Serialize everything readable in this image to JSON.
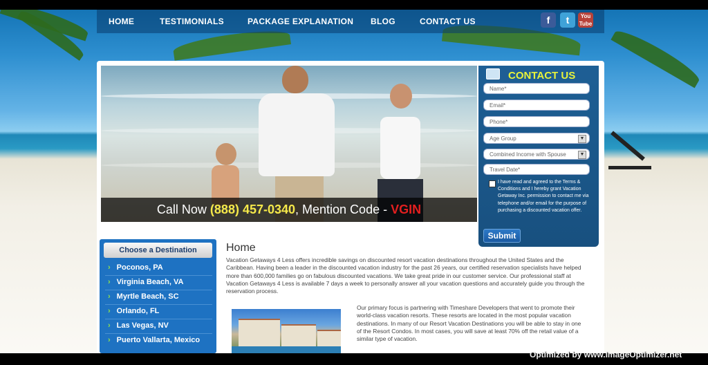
{
  "nav": {
    "items": [
      "HOME",
      "TESTIMONIALS",
      "PACKAGE EXPLANATION",
      "BLOG",
      "CONTACT US"
    ]
  },
  "social": {
    "facebook": "f",
    "twitter": "t",
    "youtube": "You Tube"
  },
  "hero": {
    "call_prefix": "Call Now ",
    "phone": "(888) 457-0340",
    "mention": ", Mention Code - ",
    "code": "VGIN"
  },
  "contact_form": {
    "title": "CONTACT US",
    "name_placeholder": "Name*",
    "email_placeholder": "Email*",
    "phone_placeholder": "Phone*",
    "age_group": "Age Group",
    "income": "Combined Income with Spouse",
    "travel_date_placeholder": "Travel Date*",
    "terms": "I have read and agreed to the Terms & Conditions and I hereby grant Vacation Getaway Inc. permission to contact me via telephone and/or email for the purpose of purchasing a discounted vacation offer.",
    "submit": "Submit"
  },
  "destinations": {
    "title": "Choose a Destination",
    "items": [
      "Poconos, PA",
      "Virginia Beach, VA",
      "Myrtle Beach, SC",
      "Orlando, FL",
      "Las Vegas, NV",
      "Puerto Vallarta, Mexico"
    ]
  },
  "main": {
    "title": "Home",
    "para1": "Vacation Getaways 4 Less offers incredible savings on discounted resort vacation destinations throughout the United States and the Caribbean. Having been a leader in the discounted vacation industry for the past 26 years, our certified reservation specialists have helped more than 600,000 families go on fabulous discounted vacations. We take great pride in our customer service. Our professional staff at Vacation Getaways 4 Less is available 7 days a week to personally answer all your vacation questions and accurately guide you through the reservation process.",
    "para2": "Our primary focus is partnering with Timeshare Developers that went to promote their world-class vacation resorts. These resorts are located in the most popular vacation destinations. In many of our Resort Vacation Destinations you will be able to stay in one of the Resort Condos. In most cases, you will save at least 70% off the retail value of a similar type of vacation."
  },
  "watermark": "Optimized by www.ImageOptimizer.net",
  "colors": {
    "accent_yellow": "#f5e84a",
    "code_red": "#e21f1f",
    "panel_blue": "#1e5f95",
    "dest_blue": "#1e72c2",
    "chevron_green": "#8fe04a"
  }
}
